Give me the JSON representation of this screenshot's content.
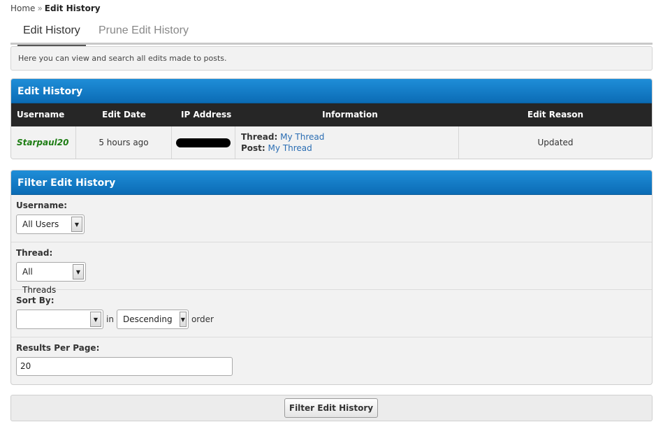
{
  "breadcrumb": {
    "home": "Home",
    "separator": "»",
    "current": "Edit History"
  },
  "tabs": [
    {
      "label": "Edit History",
      "active": true
    },
    {
      "label": "Prune Edit History",
      "active": false
    }
  ],
  "intro_text": "Here you can view and search all edits made to posts.",
  "history_table": {
    "title": "Edit History",
    "columns": [
      "Username",
      "Edit Date",
      "IP Address",
      "Information",
      "Edit Reason"
    ],
    "rows": [
      {
        "username": "Starpaul20",
        "edit_date": "5 hours ago",
        "thread_label": "Thread:",
        "thread_value": "My Thread",
        "post_label": "Post:",
        "post_value": "My Thread",
        "edit_reason": "Updated"
      }
    ]
  },
  "filter": {
    "title": "Filter Edit History",
    "username_label": "Username:",
    "username_value": "All Users",
    "thread_label": "Thread:",
    "thread_value": "All Threads",
    "sortby_label": "Sort By:",
    "sortby_value": "",
    "in_text": "in",
    "order_value": "Descending",
    "order_text": "order",
    "perpage_label": "Results Per Page:",
    "perpage_value": "20",
    "submit_label": "Filter Edit History"
  },
  "colors": {
    "header_blue": "#0b6cb5",
    "grid_head": "#262626",
    "username_green": "#1e7d14",
    "link_blue": "#2a6db3"
  },
  "icons": {
    "dropdown": "chevron-down-icon"
  }
}
